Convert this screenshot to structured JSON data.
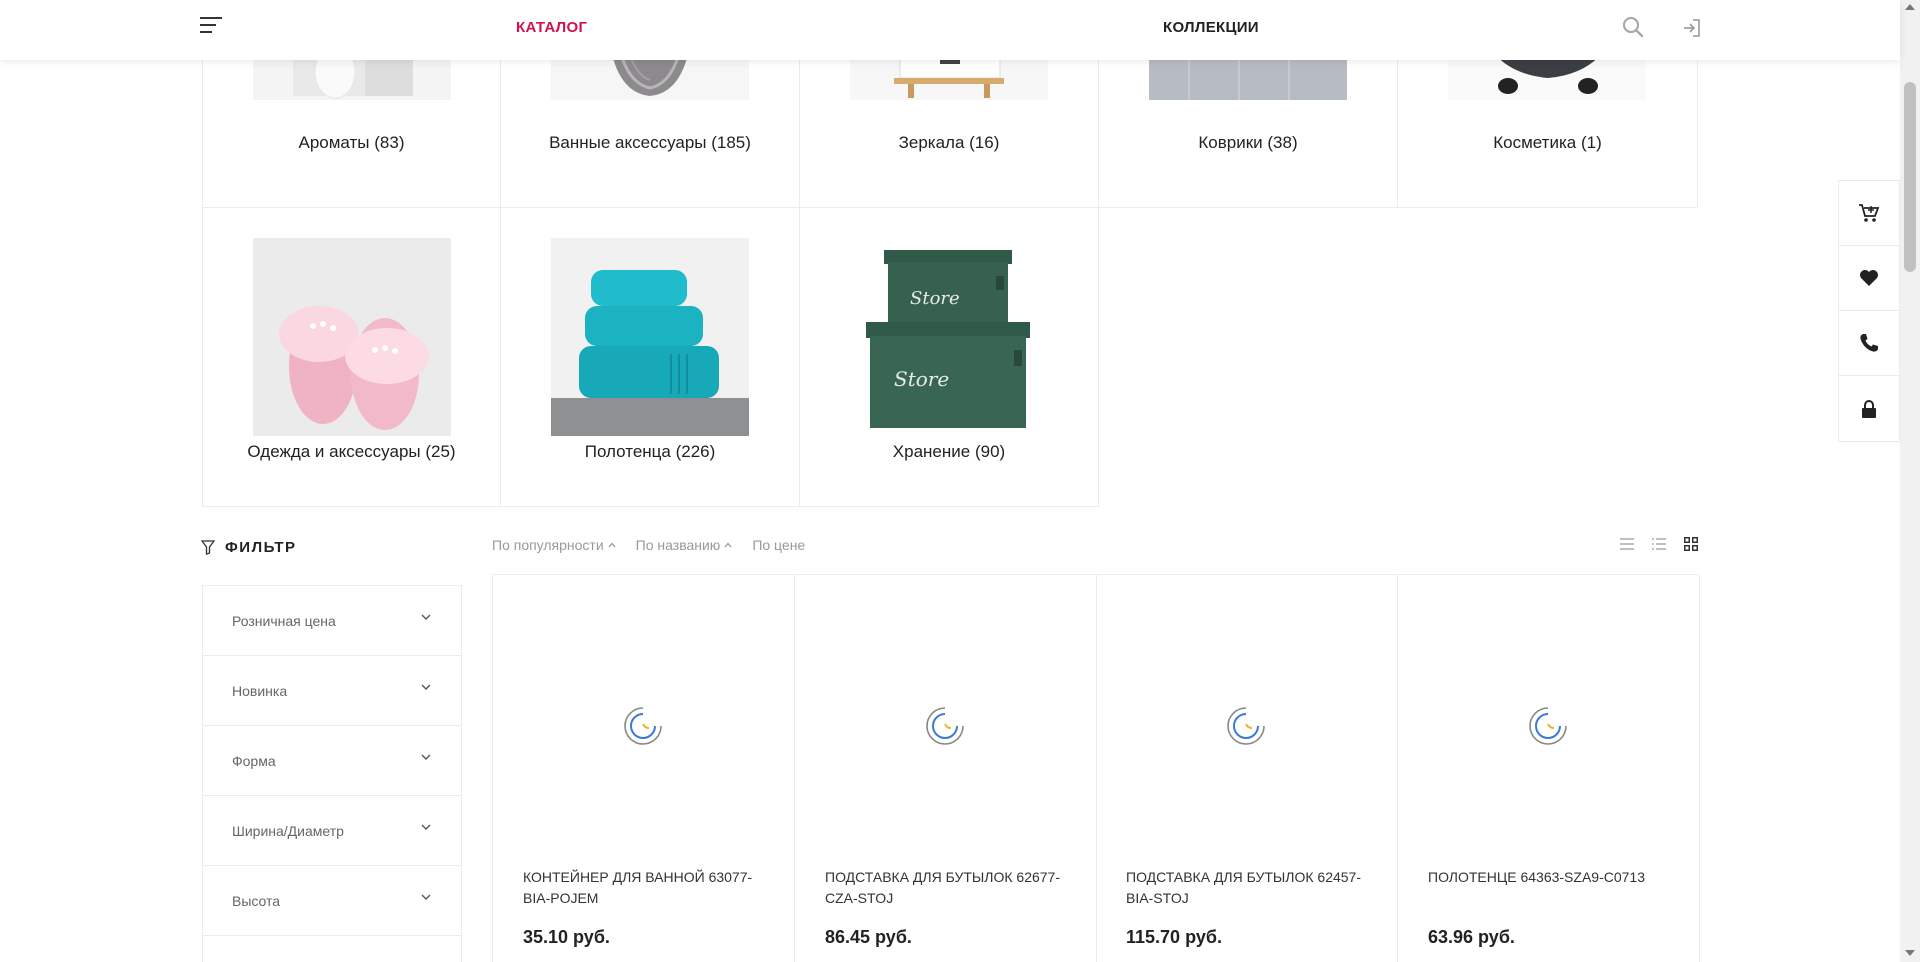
{
  "header": {
    "catalog_label": "КАТАЛОГ",
    "collections_label": "КОЛЛЕКЦИИ",
    "accent_color": "#d1134d"
  },
  "categories": [
    {
      "label": "Ароматы (83)",
      "icon": "aroma-image"
    },
    {
      "label": "Ванные аксессуары (185)",
      "icon": "bath-accessory-image"
    },
    {
      "label": "Зеркала (16)",
      "icon": "mirror-image"
    },
    {
      "label": "Коврики (38)",
      "icon": "rug-image"
    },
    {
      "label": "Косметика (1)",
      "icon": "cosmetics-image"
    },
    {
      "label": "Одежда и аксессуары (25)",
      "icon": "slippers-image"
    },
    {
      "label": "Полотенца (226)",
      "icon": "towels-image"
    },
    {
      "label": "Хранение (90)",
      "icon": "storage-boxes-image",
      "box_text": "Store"
    }
  ],
  "filter": {
    "title": "ФИЛЬТР",
    "items": [
      {
        "label": "Розничная цена"
      },
      {
        "label": "Новинка"
      },
      {
        "label": "Форма"
      },
      {
        "label": "Ширина/Диаметр"
      },
      {
        "label": "Высота"
      }
    ]
  },
  "sort": {
    "items": [
      {
        "label": "По популярности",
        "arrow": "up"
      },
      {
        "label": "По названию",
        "arrow": "up"
      },
      {
        "label": "По цене",
        "arrow": "none"
      }
    ],
    "views": [
      "list-view-icon",
      "detailed-list-view-icon",
      "grid-view-icon"
    ],
    "active_view": "grid-view-icon"
  },
  "products": [
    {
      "name": "КОНТЕЙНЕР ДЛЯ ВАННОЙ 63077-BIA-POJEM",
      "price": "35.10 руб."
    },
    {
      "name": "ПОДСТАВКА ДЛЯ БУТЫЛОК 62677-CZA-STOJ",
      "price": "86.45 руб."
    },
    {
      "name": "ПОДСТАВКА ДЛЯ БУТЫЛОК 62457-BIA-STOJ",
      "price": "115.70 руб."
    },
    {
      "name": "ПОЛОТЕНЦЕ 64363-SZA9-C0713",
      "price": "63.96 руб."
    }
  ],
  "side_panel": [
    "cart-icon",
    "heart-icon",
    "phone-icon",
    "lock-icon"
  ]
}
